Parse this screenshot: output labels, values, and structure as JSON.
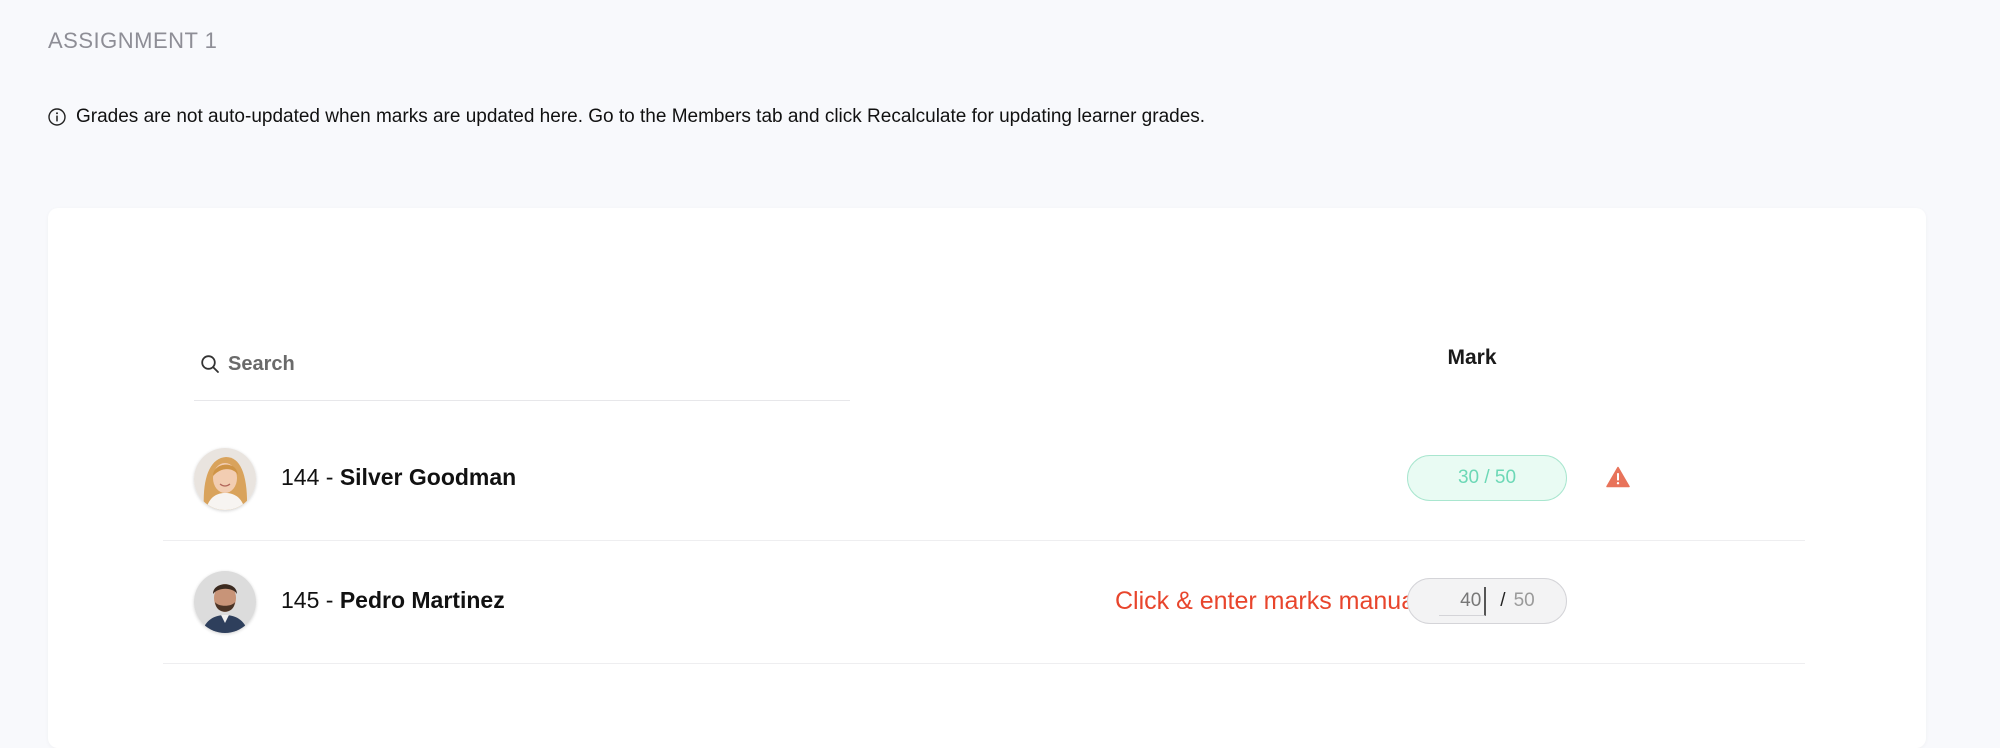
{
  "page": {
    "title": "ASSIGNMENT 1",
    "info_text": "Grades are not auto-updated when marks are updated here. Go to the Members tab and click Recalculate for updating learner grades."
  },
  "search": {
    "placeholder": "Search",
    "value": ""
  },
  "table": {
    "mark_header": "Mark",
    "rows": [
      {
        "prefix": "144 - ",
        "name": "Silver Goodman",
        "mark": "30 / 50",
        "status_icon": "warning-icon"
      },
      {
        "prefix": "145 - ",
        "name": "Pedro Martinez",
        "hint": "Click & enter marks manually",
        "mark_value": "40",
        "mark_separator": "/",
        "mark_total": "50"
      }
    ]
  },
  "colors": {
    "accent_green": "#6cd8b6",
    "hint_red": "#e8452c",
    "warning_red": "#e8735a"
  }
}
